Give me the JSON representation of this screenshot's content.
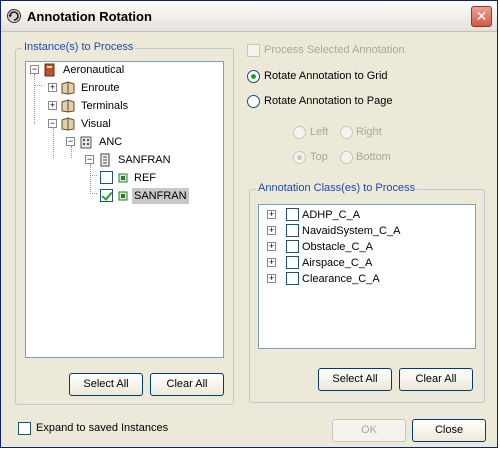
{
  "window": {
    "title": "Annotation Rotation"
  },
  "instances": {
    "legend": "Instance(s) to Process",
    "tree": {
      "root": "Aeronautical",
      "enroute": "Enroute",
      "terminals": "Terminals",
      "visual": "Visual",
      "anc": "ANC",
      "sanfran_parent": "SANFRAN",
      "ref": "REF",
      "sanfran_child": "SANFRAN"
    },
    "select_all": "Select All",
    "clear_all": "Clear All"
  },
  "options": {
    "process_selected": "Process Selected Annotation",
    "rotate_grid": "Rotate Annotation to Grid",
    "rotate_page": "Rotate Annotation to Page",
    "left": "Left",
    "right": "Right",
    "top": "Top",
    "bottom": "Bottom"
  },
  "classes": {
    "legend": "Annotation Class(es) to Process",
    "items": [
      "ADHP_C_A",
      "NavaidSystem_C_A",
      "Obstacle_C_A",
      "Airspace_C_A",
      "Clearance_C_A"
    ],
    "select_all": "Select All",
    "clear_all": "Clear All"
  },
  "footer": {
    "expand_label": "Expand to saved Instances",
    "ok": "OK",
    "close": "Close"
  },
  "colors": {
    "accent": "#1f46b8",
    "check": "#21a121",
    "selected_bg": "#c8c8c8"
  }
}
